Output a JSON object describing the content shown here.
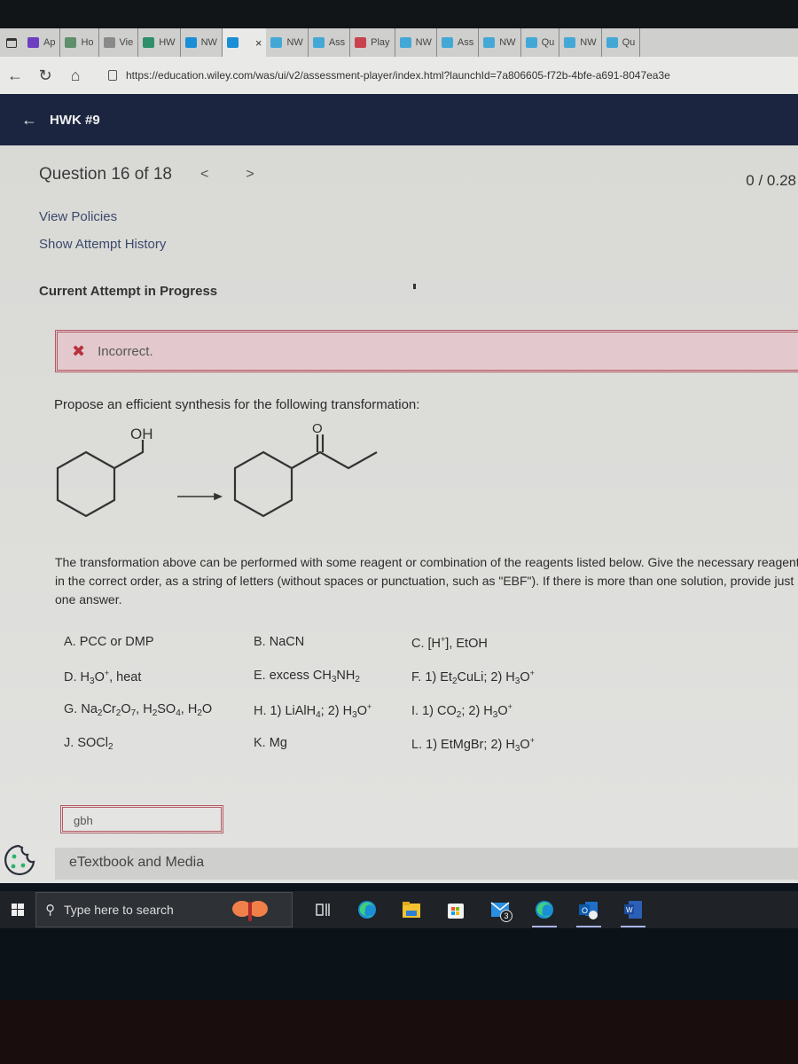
{
  "browser": {
    "tabs": [
      {
        "label": "Ap",
        "icon": "yahoo-icon",
        "color": "#6b3fc0"
      },
      {
        "label": "Ho",
        "icon": "wiley-w-icon",
        "color": "#5f8f6a"
      },
      {
        "label": "Vie",
        "icon": "grid-icon",
        "color": "#8a8a8a"
      },
      {
        "label": "HW",
        "icon": "p-icon",
        "color": "#2f8f6a"
      },
      {
        "label": "NW",
        "icon": "wp-icon",
        "color": "#1b8fd6"
      },
      {
        "label": "",
        "icon": "wp-icon",
        "color": "#1b8fd6",
        "active": true
      },
      {
        "label": "NW",
        "icon": "wp-icon",
        "color": "#44a8d6"
      },
      {
        "label": "Ass",
        "icon": "wp-icon",
        "color": "#44a8d6"
      },
      {
        "label": "Play",
        "icon": "angular-icon",
        "color": "#c9434f"
      },
      {
        "label": "NW",
        "icon": "wp-icon",
        "color": "#44a8d6"
      },
      {
        "label": "Ass",
        "icon": "wp-icon",
        "color": "#44a8d6"
      },
      {
        "label": "NW",
        "icon": "wp-icon",
        "color": "#44a8d6"
      },
      {
        "label": "Qu",
        "icon": "wp-icon",
        "color": "#44a8d6"
      },
      {
        "label": "NW",
        "icon": "wp-icon",
        "color": "#44a8d6"
      },
      {
        "label": "Qu",
        "icon": "wp-icon",
        "color": "#44a8d6"
      }
    ],
    "active_tab_close": "×",
    "url": "https://education.wiley.com/was/ui/v2/assessment-player/index.html?launchId=7a806605-f72b-4bfe-a691-8047ea3e"
  },
  "header": {
    "back_label": "←",
    "title": "HWK #9"
  },
  "question": {
    "counter": "Question 16 of 18",
    "prev": "<",
    "next": ">",
    "score": "0 / 0.28",
    "view_policies": "View Policies",
    "show_attempt_history": "Show Attempt History",
    "attempt_status": "Current Attempt in Progress",
    "feedback": "Incorrect.",
    "prompt": "Propose an efficient synthesis for the following transformation:",
    "reactant_label": "OH",
    "product_label": "O",
    "instructions": "The transformation above can be performed with some reagent or combination of the reagents listed below. Give the necessary reagents in the correct order, as a string of letters (without spaces or punctuation, such as \"EBF\"). If there is more than one solution, provide just one answer.",
    "answer_value": "gbh"
  },
  "reagents": [
    {
      "letter": "A.",
      "html": "PCC or DMP"
    },
    {
      "letter": "B.",
      "html": "NaCN"
    },
    {
      "letter": "C.",
      "html": "[H<sup>+</sup>], EtOH"
    },
    {
      "letter": "D.",
      "html": "H<sub>3</sub>O<sup>+</sup>, heat"
    },
    {
      "letter": "E.",
      "html": "excess CH<sub>3</sub>NH<sub>2</sub>"
    },
    {
      "letter": "F.",
      "html": "1) Et<sub>2</sub>CuLi; 2) H<sub>3</sub>O<sup>+</sup>"
    },
    {
      "letter": "G.",
      "html": "Na<sub>2</sub>Cr<sub>2</sub>O<sub>7</sub>, H<sub>2</sub>SO<sub>4</sub>, H<sub>2</sub>O"
    },
    {
      "letter": "H.",
      "html": "1) LiAlH<sub>4</sub>; 2) H<sub>3</sub>O<sup>+</sup>"
    },
    {
      "letter": "I.",
      "html": "1) CO<sub>2</sub>; 2) H<sub>3</sub>O<sup>+</sup>"
    },
    {
      "letter": "J.",
      "html": "SOCl<sub>2</sub>"
    },
    {
      "letter": "K.",
      "html": "Mg"
    },
    {
      "letter": "L.",
      "html": "1) EtMgBr; 2) H<sub>3</sub>O<sup>+</sup>"
    }
  ],
  "etextbook": "eTextbook and Media",
  "taskbar": {
    "search_placeholder": "Type here to search",
    "mail_badge": "3",
    "apps": [
      "task-view",
      "edge",
      "file-explorer",
      "store",
      "mail",
      "edge-active",
      "outlook",
      "word"
    ]
  }
}
